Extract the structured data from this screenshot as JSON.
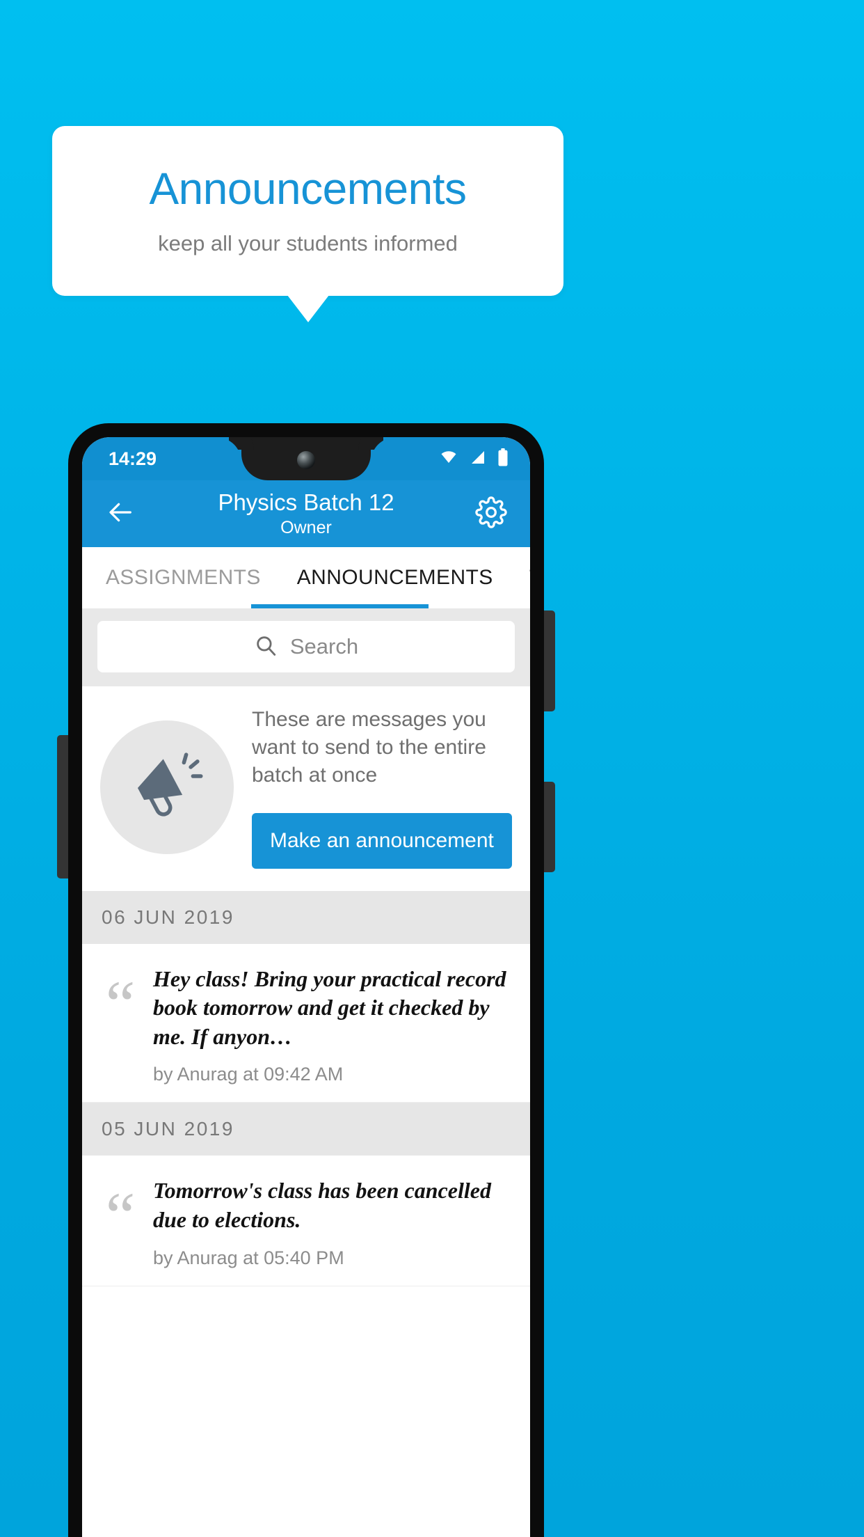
{
  "promo": {
    "title": "Announcements",
    "subtitle": "keep all your students informed",
    "title_color": "#1793D6",
    "background_color": "#00B4E8"
  },
  "phone": {
    "statusbar": {
      "time": "14:29",
      "icons": [
        "wifi-icon",
        "signal-icon",
        "battery-icon"
      ]
    },
    "appbar": {
      "back_icon": "arrow-left-icon",
      "title": "Physics Batch 12",
      "subtitle": "Owner",
      "settings_icon": "gear-icon",
      "background_color": "#1793D6"
    },
    "tabs": [
      {
        "label": "ASSIGNMENTS",
        "active": false
      },
      {
        "label": "ANNOUNCEMENTS",
        "active": true
      },
      {
        "label": "TESTS",
        "active": false
      },
      {
        "label": "’",
        "active": false
      }
    ],
    "search": {
      "placeholder": "Search",
      "value": "",
      "icon": "search-icon"
    },
    "empty_state": {
      "icon": "megaphone-icon",
      "description": "These are messages you want to send to the entire batch at once",
      "button_label": "Make an announcement"
    },
    "announcement_groups": [
      {
        "date": "06 JUN 2019",
        "items": [
          {
            "text": "Hey class! Bring your practical record book tomorrow and get it checked by me. If anyon…",
            "meta": "by Anurag at 09:42 AM"
          }
        ]
      },
      {
        "date": "05 JUN 2019",
        "items": [
          {
            "text": "Tomorrow's class has been cancelled due to elections.",
            "meta": "by Anurag at 05:40 PM"
          }
        ]
      }
    ]
  }
}
